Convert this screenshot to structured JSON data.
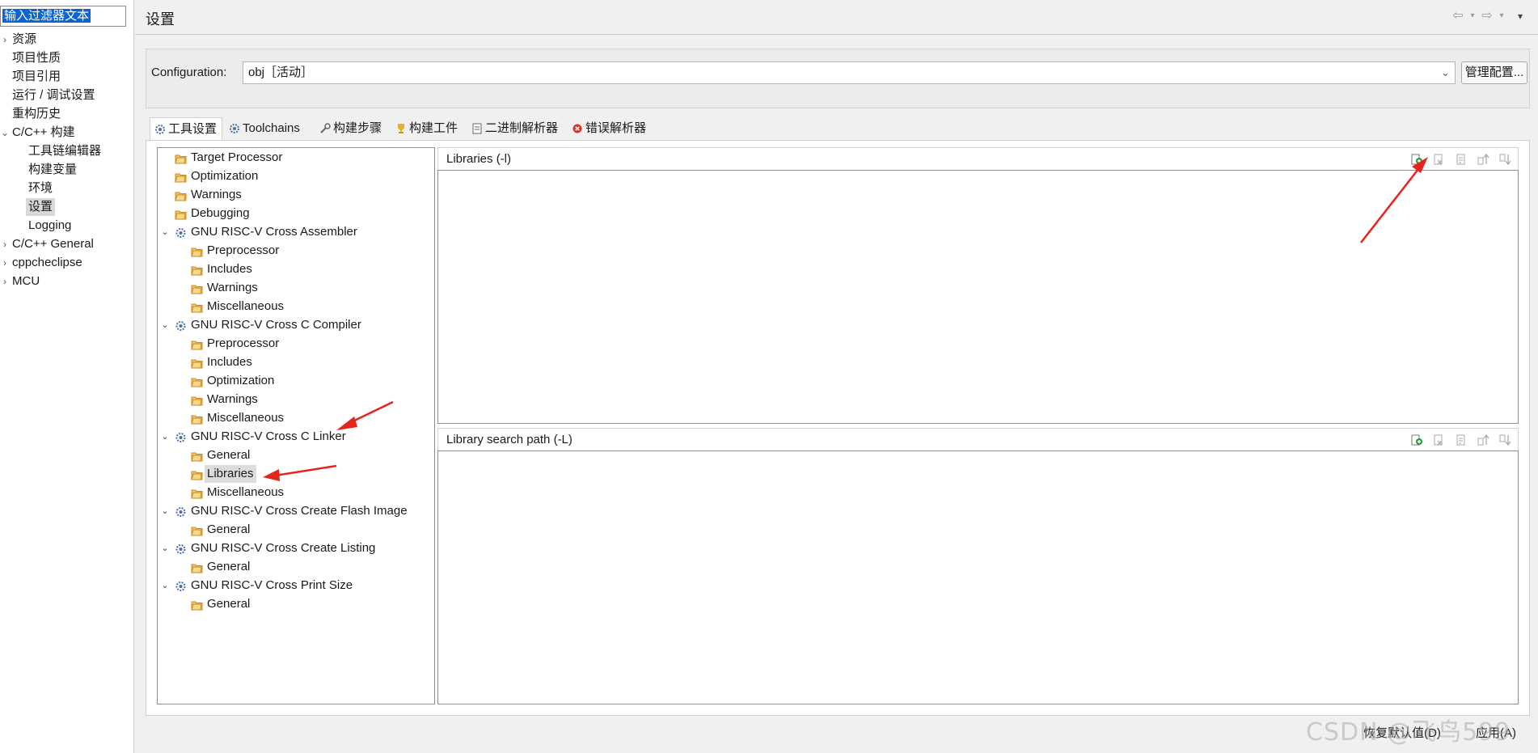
{
  "filter": {
    "value": "输入过滤器文本"
  },
  "nav": {
    "items": [
      {
        "label": "资源",
        "arrow": "›"
      },
      {
        "label": "项目性质"
      },
      {
        "label": "项目引用"
      },
      {
        "label": "运行 / 调试设置"
      },
      {
        "label": "重构历史"
      },
      {
        "label": "C/C++ 构建",
        "arrow": "⌄"
      },
      {
        "label": "工具链编辑器"
      },
      {
        "label": "构建变量"
      },
      {
        "label": "环境"
      },
      {
        "label": "设置"
      },
      {
        "label": "Logging"
      },
      {
        "label": "C/C++ General",
        "arrow": "›"
      },
      {
        "label": "cppcheclipse",
        "arrow": "›"
      },
      {
        "label": "MCU",
        "arrow": "›"
      }
    ]
  },
  "page": {
    "title": "设置"
  },
  "config": {
    "label": "Configuration:",
    "value": "obj［活动］",
    "manage_button": "管理配置..."
  },
  "tabs": [
    {
      "label": "工具设置"
    },
    {
      "label": "Toolchains"
    },
    {
      "label": "构建步骤"
    },
    {
      "label": "构建工件"
    },
    {
      "label": "二进制解析器"
    },
    {
      "label": "错误解析器"
    }
  ],
  "tree": [
    {
      "label": "Target Processor"
    },
    {
      "label": "Optimization"
    },
    {
      "label": "Warnings"
    },
    {
      "label": "Debugging"
    },
    {
      "label": "GNU RISC-V Cross Assembler"
    },
    {
      "label": "Preprocessor"
    },
    {
      "label": "Includes"
    },
    {
      "label": "Warnings"
    },
    {
      "label": "Miscellaneous"
    },
    {
      "label": "GNU RISC-V Cross C Compiler"
    },
    {
      "label": "Preprocessor"
    },
    {
      "label": "Includes"
    },
    {
      "label": "Optimization"
    },
    {
      "label": "Warnings"
    },
    {
      "label": "Miscellaneous"
    },
    {
      "label": "GNU RISC-V Cross C Linker"
    },
    {
      "label": "General"
    },
    {
      "label": "Libraries"
    },
    {
      "label": "Miscellaneous"
    },
    {
      "label": "GNU RISC-V Cross Create Flash Image"
    },
    {
      "label": "General"
    },
    {
      "label": "GNU RISC-V Cross Create Listing"
    },
    {
      "label": "General"
    },
    {
      "label": "GNU RISC-V Cross Print Size"
    },
    {
      "label": "General"
    }
  ],
  "panels": {
    "libraries": {
      "title": "Libraries (-l)"
    },
    "library_paths": {
      "title": "Library search path (-L)"
    }
  },
  "buttons": {
    "restore_defaults": "恢复默认值(D)",
    "apply": "应用(A)"
  },
  "watermark": "CSDN @飞鸟599",
  "colors": {
    "selection": "#0a64d6",
    "annotation_arrow": "#e8231b",
    "folder_icon": "#e8a33a",
    "add_icon": "#2e9a3a"
  }
}
